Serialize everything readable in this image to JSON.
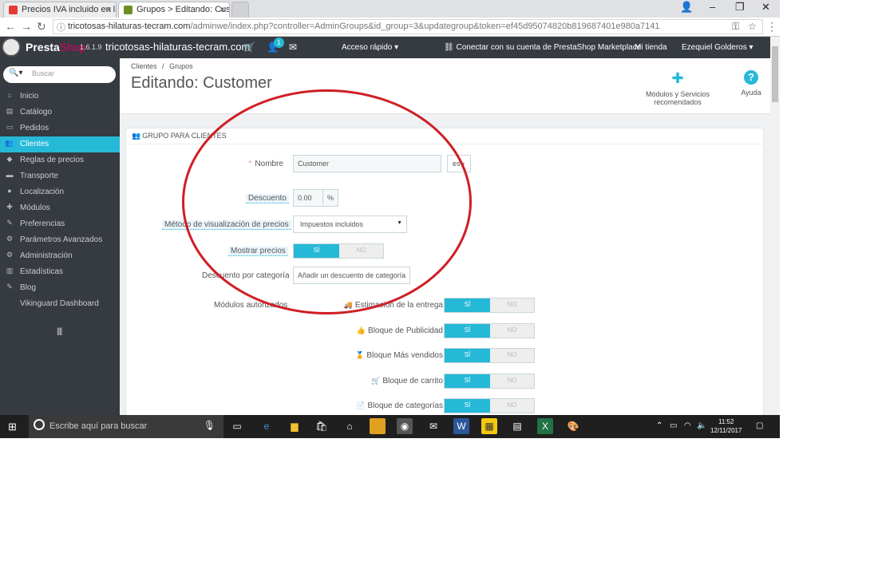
{
  "browser": {
    "tabs": [
      {
        "title": "Precios IVA incluido en la",
        "favicon_color": "#e53935"
      },
      {
        "title": "Grupos > Editando: Cust",
        "favicon_color": "#6b8e23"
      }
    ],
    "url_host": "tricotosas-hilaturas-tecram.com",
    "url_path": "/adminwe/index.php?controller=AdminGroups&id_group=3&updategroup&token=ef45d95074820b819687401e980a7141"
  },
  "header": {
    "logo_presta": "Presta",
    "logo_shop": "Shop",
    "version": "1.6.1.9",
    "shop_name": "tricotosas-hilaturas-tecram.com",
    "notif_count": "1",
    "quick_access": "Acceso rápido ▾",
    "marketplace": "Conectar con su cuenta de PrestaShop Marketplace",
    "my_shop": "Mi tienda",
    "employee": "Ezequiel Golderos ▾"
  },
  "sidebar": {
    "search_placeholder": "Buscar",
    "items": [
      {
        "label": "Inicio",
        "icon": "home-icon",
        "glyph": "⌂"
      },
      {
        "label": "Catálogo",
        "icon": "book-icon",
        "glyph": "▤"
      },
      {
        "label": "Pedidos",
        "icon": "credit-card-icon",
        "glyph": "▭"
      },
      {
        "label": "Clientes",
        "icon": "users-icon",
        "glyph": "👥"
      },
      {
        "label": "Reglas de precios",
        "icon": "tag-icon",
        "glyph": "◆"
      },
      {
        "label": "Transporte",
        "icon": "truck-icon",
        "glyph": "▬"
      },
      {
        "label": "Localización",
        "icon": "globe-icon",
        "glyph": "●"
      },
      {
        "label": "Módulos",
        "icon": "puzzle-icon",
        "glyph": "✚"
      },
      {
        "label": "Preferencias",
        "icon": "wrench-icon",
        "glyph": "✎"
      },
      {
        "label": "Parámetros Avanzados",
        "icon": "cogs-icon",
        "glyph": "⚙"
      },
      {
        "label": "Administración",
        "icon": "cog-icon",
        "glyph": "⚙"
      },
      {
        "label": "Estadísticas",
        "icon": "bar-chart-icon",
        "glyph": "▥"
      },
      {
        "label": "Blog",
        "icon": "edit-icon",
        "glyph": "✎"
      },
      {
        "label": "Vikinguard Dashboard",
        "icon": "",
        "glyph": ""
      }
    ],
    "active_index": 3,
    "collapse_glyph": "||||"
  },
  "page": {
    "breadcrumb_1": "Clientes",
    "breadcrumb_sep": "/",
    "breadcrumb_2": "Grupos",
    "title": "Editando: Customer",
    "toolbar_modules": "Módulos y Servicios recomendados",
    "toolbar_help": "Ayuda"
  },
  "form": {
    "panel_title": "GRUPO PARA CLIENTES",
    "name_label": "Nombre",
    "name_value": "Customer",
    "lang": "es",
    "discount_label": "Descuento",
    "discount_value": "0.00",
    "discount_unit": "%",
    "display_method_label": "Método de visualización de precios",
    "display_method_value": "Impuestos incluidos",
    "show_prices_label": "Mostrar precios",
    "yes": "SÍ",
    "no": "NO",
    "category_discount_label": "Descuento por categoría",
    "category_discount_button": "Añadir un descuento de categoría",
    "modules_label": "Módulos autorizados",
    "modules": [
      {
        "label": "Estimación de la entrega",
        "icon": "truck-module-icon",
        "glyph": "🚚"
      },
      {
        "label": "Bloque de Publicidad",
        "icon": "ad-module-icon",
        "glyph": "👍"
      },
      {
        "label": "Bloque Más vendidos",
        "icon": "bestseller-module-icon",
        "glyph": "🏅"
      },
      {
        "label": "Bloque de carrito",
        "icon": "cart-module-icon",
        "glyph": "🛒"
      },
      {
        "label": "Bloque de categorías",
        "icon": "category-module-icon",
        "glyph": "📄"
      }
    ]
  },
  "taskbar": {
    "search_placeholder": "Escribe aquí para buscar",
    "time": "11:52",
    "date": "12/11/2017"
  },
  "colors": {
    "accent": "#25b9d7",
    "header_bg": "#363a41",
    "annotation": "#cf1f25"
  }
}
